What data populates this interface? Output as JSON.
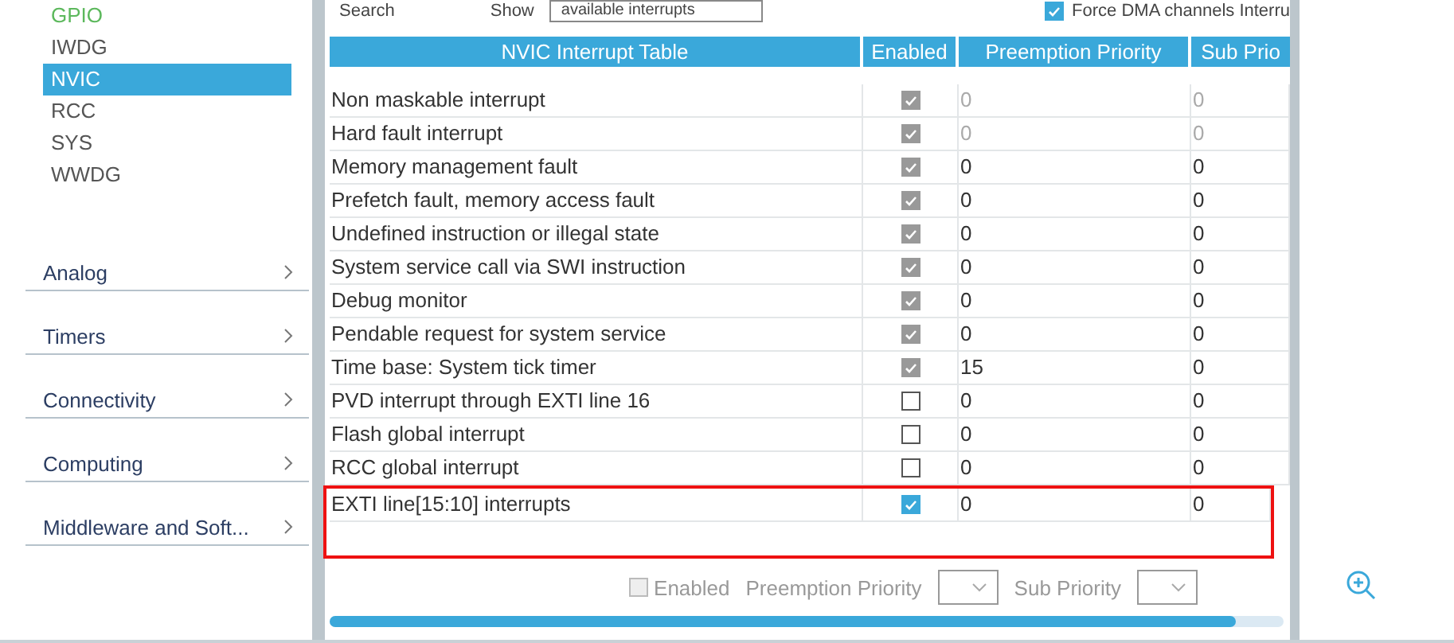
{
  "sidebar": {
    "items": [
      {
        "label": "GPIO",
        "configured": true,
        "selected": false
      },
      {
        "label": "IWDG",
        "configured": false,
        "selected": false
      },
      {
        "label": "NVIC",
        "configured": false,
        "selected": true
      },
      {
        "label": "RCC",
        "configured": false,
        "selected": false
      },
      {
        "label": "SYS",
        "configured": false,
        "selected": false
      },
      {
        "label": "WWDG",
        "configured": false,
        "selected": false
      }
    ],
    "categories": [
      {
        "label": "Analog"
      },
      {
        "label": "Timers"
      },
      {
        "label": "Connectivity"
      },
      {
        "label": "Computing"
      },
      {
        "label": "Middleware and Soft..."
      }
    ]
  },
  "toolbar": {
    "search_label": "Search",
    "show_label": "Show",
    "show_value": "available interrupts",
    "force_dma": {
      "label": "Force DMA channels Interru",
      "checked": true
    }
  },
  "table": {
    "title": "NVIC Interrupt Table",
    "columns": [
      "Enabled",
      "Preemption Priority",
      "Sub Prio"
    ],
    "rows": [
      {
        "name": "Non maskable interrupt",
        "enabled": true,
        "kind": "fixed",
        "priority_locked": true,
        "preemption": "0",
        "sub": "0",
        "highlighted": false
      },
      {
        "name": "Hard fault interrupt",
        "enabled": true,
        "kind": "fixed",
        "priority_locked": true,
        "preemption": "0",
        "sub": "0",
        "highlighted": false
      },
      {
        "name": "Memory management fault",
        "enabled": true,
        "kind": "fixed",
        "priority_locked": false,
        "preemption": "0",
        "sub": "0",
        "highlighted": false
      },
      {
        "name": "Prefetch fault, memory access fault",
        "enabled": true,
        "kind": "fixed",
        "priority_locked": false,
        "preemption": "0",
        "sub": "0",
        "highlighted": false
      },
      {
        "name": "Undefined instruction or illegal state",
        "enabled": true,
        "kind": "fixed",
        "priority_locked": false,
        "preemption": "0",
        "sub": "0",
        "highlighted": false
      },
      {
        "name": "System service call via SWI instruction",
        "enabled": true,
        "kind": "fixed",
        "priority_locked": false,
        "preemption": "0",
        "sub": "0",
        "highlighted": false
      },
      {
        "name": "Debug monitor",
        "enabled": true,
        "kind": "fixed",
        "priority_locked": false,
        "preemption": "0",
        "sub": "0",
        "highlighted": false
      },
      {
        "name": "Pendable request for system service",
        "enabled": true,
        "kind": "fixed",
        "priority_locked": false,
        "preemption": "0",
        "sub": "0",
        "highlighted": false
      },
      {
        "name": "Time base: System tick timer",
        "enabled": true,
        "kind": "fixed",
        "priority_locked": false,
        "preemption": "15",
        "sub": "0",
        "highlighted": false
      },
      {
        "name": "PVD interrupt through EXTI line 16",
        "enabled": false,
        "kind": "optional",
        "priority_locked": false,
        "preemption": "0",
        "sub": "0",
        "highlighted": false
      },
      {
        "name": "Flash global interrupt",
        "enabled": false,
        "kind": "optional",
        "priority_locked": false,
        "preemption": "0",
        "sub": "0",
        "highlighted": false
      },
      {
        "name": "RCC global interrupt",
        "enabled": false,
        "kind": "optional",
        "priority_locked": false,
        "preemption": "0",
        "sub": "0",
        "highlighted": false
      },
      {
        "name": "EXTI line[15:10] interrupts",
        "enabled": true,
        "kind": "optional",
        "priority_locked": false,
        "preemption": "0",
        "sub": "0",
        "highlighted": true
      }
    ]
  },
  "editor": {
    "enabled": {
      "label": "Enabled",
      "checked": false,
      "disabled": true
    },
    "preemption_label": "Preemption Priority",
    "sub_label": "Sub Priority"
  }
}
